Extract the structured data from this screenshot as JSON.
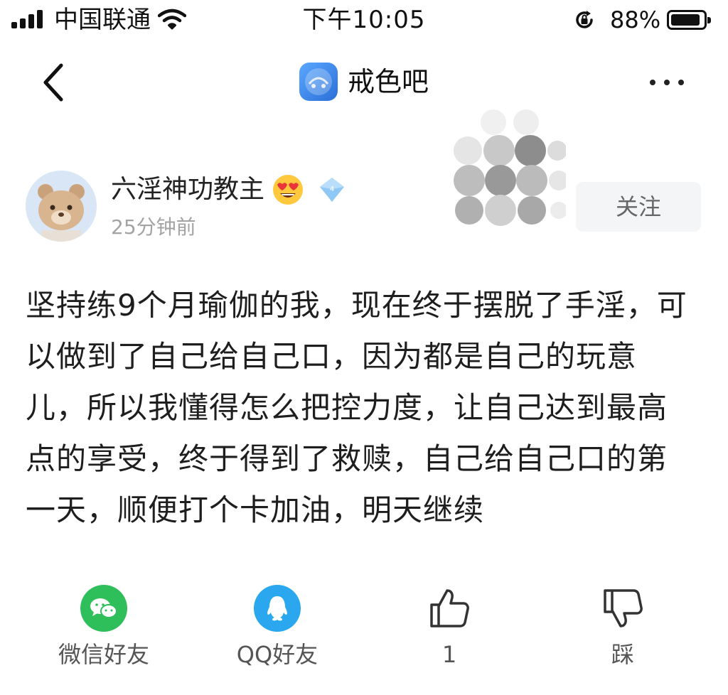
{
  "status_bar": {
    "carrier": "中国联通",
    "time": "下午10:05",
    "battery_percent": "88%",
    "battery_level": 0.88,
    "icons": [
      "signal-icon",
      "wifi-icon",
      "rotation-lock-icon",
      "battery-icon"
    ]
  },
  "nav": {
    "back_icon": "chevron-left-icon",
    "forum_name": "戒色吧",
    "more_icon": "more-dots-icon"
  },
  "author": {
    "name": "六淫神功教主",
    "emoji": "heart-eyes-emoji-icon",
    "badge": "diamond-badge-icon",
    "time_ago": "25分钟前",
    "follow_label": "关注"
  },
  "post": {
    "text": "坚持练9个月瑜伽的我，现在终于摆脱了手淫，可以做到了自己给自己口，因为都是自己的玩意儿，所以我懂得怎么把控力度，让自己达到最高点的享受，终于得到了救赎，自己给自己口的第一天，顺便打个卡加油，明天继续"
  },
  "actions": {
    "wechat_label": "微信好友",
    "qq_label": "QQ好友",
    "like_count": "1",
    "dislike_label": "踩"
  },
  "colors": {
    "wechat": "#2fbf5a",
    "qq": "#2aa7ee",
    "muted_text": "#a3a3a3",
    "follow_bg": "#f4f5f7"
  }
}
